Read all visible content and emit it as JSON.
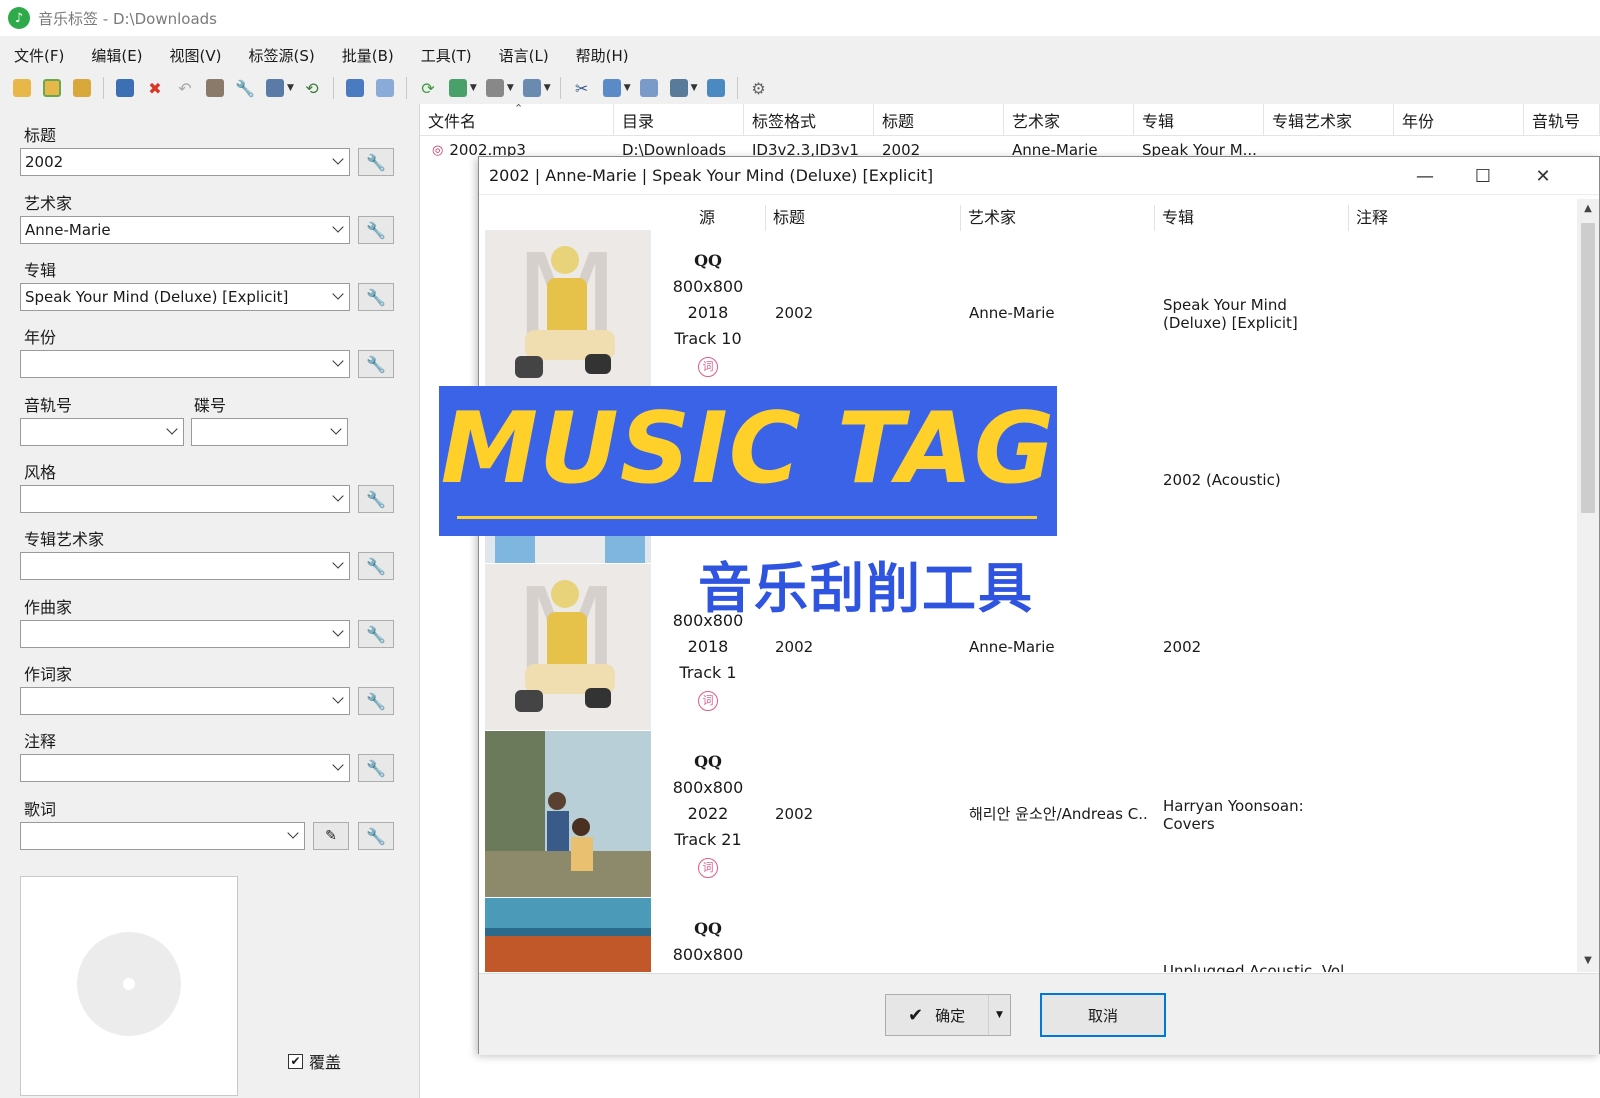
{
  "window": {
    "title": "音乐标签 - D:\\Downloads",
    "icon": "music-note-icon"
  },
  "menu": [
    "文件(F)",
    "编辑(E)",
    "视图(V)",
    "标签源(S)",
    "批量(B)",
    "工具(T)",
    "语言(L)",
    "帮助(H)"
  ],
  "toolbar_icons": [
    "open-folder-icon",
    "add-folder-icon",
    "folders-icon",
    "save-icon",
    "delete-icon",
    "undo-icon",
    "book-icon",
    "wrench-icon",
    "tag-source-icon",
    "history-icon",
    "grid-icon",
    "table-icon",
    "refresh-icon",
    "image-icon",
    "format-icon",
    "export-icon",
    "tools-icon",
    "copy-icon",
    "window-icon",
    "batch-icon",
    "panel-icon",
    "settings-icon"
  ],
  "fields": {
    "title": {
      "label": "标题",
      "value": "2002"
    },
    "artist": {
      "label": "艺术家",
      "value": "Anne-Marie"
    },
    "album": {
      "label": "专辑",
      "value": "Speak Your Mind (Deluxe) [Explicit]"
    },
    "year": {
      "label": "年份",
      "value": ""
    },
    "track": {
      "label": "音轨号",
      "value": ""
    },
    "disc": {
      "label": "碟号",
      "value": ""
    },
    "genre": {
      "label": "风格",
      "value": ""
    },
    "album_artist": {
      "label": "专辑艺术家",
      "value": ""
    },
    "composer": {
      "label": "作曲家",
      "value": ""
    },
    "lyricist": {
      "label": "作词家",
      "value": ""
    },
    "comment": {
      "label": "注释",
      "value": ""
    },
    "lyrics": {
      "label": "歌词",
      "value": ""
    }
  },
  "overwrite": {
    "label": "覆盖",
    "checked": true
  },
  "filelist": {
    "columns": [
      "文件名",
      "目录",
      "标签格式",
      "标题",
      "艺术家",
      "专辑",
      "专辑艺术家",
      "年份",
      "音轨号"
    ],
    "rows": [
      {
        "filename": "2002.mp3",
        "dir": "D:\\Downloads",
        "format": "ID3v2.3,ID3v1",
        "title": "2002",
        "artist": "Anne-Marie",
        "album": "Speak Your M..."
      }
    ]
  },
  "dialog": {
    "title": "2002 | Anne-Marie | Speak Your Mind (Deluxe) [Explicit]",
    "columns": [
      "源",
      "标题",
      "艺术家",
      "专辑",
      "注释"
    ],
    "rows": [
      {
        "source": "QQ",
        "size": "800x800",
        "year": "2018",
        "track": "Track 10",
        "lyric": "词",
        "title": "2002",
        "artist": "Anne-Marie",
        "album": "Speak Your Mind (Deluxe) [Explicit]"
      },
      {
        "source": "",
        "size": "",
        "year": "",
        "track": "",
        "lyric": "",
        "title": "",
        "artist": "",
        "album": "2002 (Acoustic)"
      },
      {
        "source": "",
        "size": "800x800",
        "year": "2018",
        "track": "Track 1",
        "lyric": "词",
        "title": "2002",
        "artist": "Anne-Marie",
        "album": "2002"
      },
      {
        "source": "QQ",
        "size": "800x800",
        "year": "2022",
        "track": "Track 21",
        "lyric": "词",
        "title": "2002",
        "artist": "해리안 윤소안/Andreas C...",
        "album": "Harryan Yoonsoan: Covers"
      },
      {
        "source": "QQ",
        "size": "800x800",
        "year": "",
        "track": "",
        "lyric": "",
        "title": "",
        "artist": "",
        "album": "Unplugged Acoustic, Vol..."
      }
    ],
    "ok_label": "确定",
    "cancel_label": "取消"
  },
  "overlay": {
    "banner": "MUSIC TAG",
    "subtitle": "音乐刮削工具",
    "banner_bg": "#3a63e8",
    "banner_fg": "#ffd02a"
  }
}
